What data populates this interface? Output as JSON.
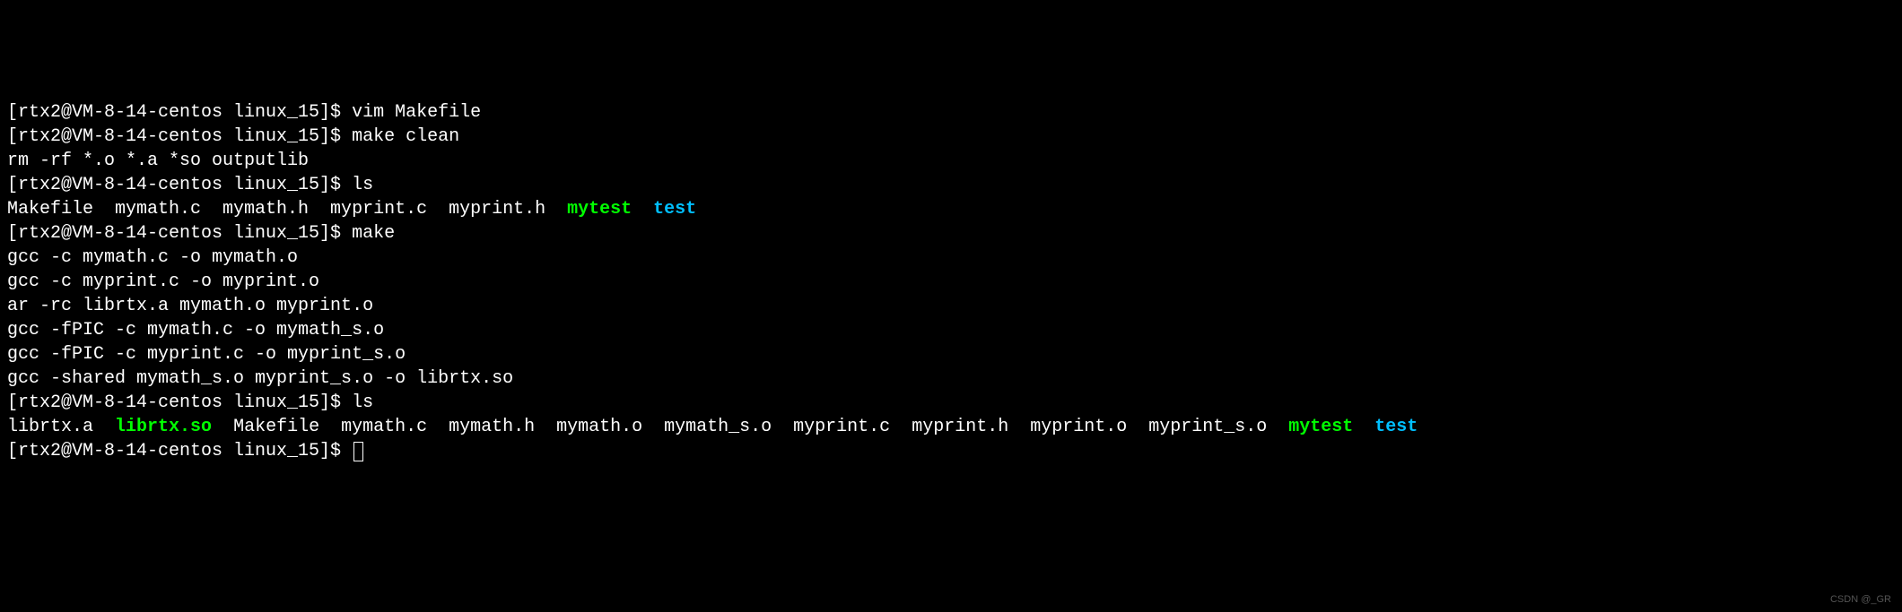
{
  "lines": [
    {
      "segments": [
        {
          "t": "[rtx2@VM-8-14-centos linux_15]$ ",
          "c": "prompt"
        },
        {
          "t": "vim Makefile",
          "c": "cmd"
        }
      ]
    },
    {
      "segments": [
        {
          "t": "[rtx2@VM-8-14-centos linux_15]$ ",
          "c": "prompt"
        },
        {
          "t": "make clean",
          "c": "cmd"
        }
      ]
    },
    {
      "segments": [
        {
          "t": "rm -rf *.o *.a *so outputlib",
          "c": "output"
        }
      ]
    },
    {
      "segments": [
        {
          "t": "[rtx2@VM-8-14-centos linux_15]$ ",
          "c": "prompt"
        },
        {
          "t": "ls",
          "c": "cmd"
        }
      ]
    },
    {
      "segments": [
        {
          "t": "Makefile  mymath.c  mymath.h  myprint.c  myprint.h  ",
          "c": "output"
        },
        {
          "t": "mytest",
          "c": "exec-green"
        },
        {
          "t": "  ",
          "c": "output"
        },
        {
          "t": "test",
          "c": "dir-blue"
        }
      ]
    },
    {
      "segments": [
        {
          "t": "[rtx2@VM-8-14-centos linux_15]$ ",
          "c": "prompt"
        },
        {
          "t": "make",
          "c": "cmd"
        }
      ]
    },
    {
      "segments": [
        {
          "t": "gcc -c mymath.c -o mymath.o",
          "c": "output"
        }
      ]
    },
    {
      "segments": [
        {
          "t": "gcc -c myprint.c -o myprint.o",
          "c": "output"
        }
      ]
    },
    {
      "segments": [
        {
          "t": "ar -rc librtx.a mymath.o myprint.o",
          "c": "output"
        }
      ]
    },
    {
      "segments": [
        {
          "t": "gcc -fPIC -c mymath.c -o mymath_s.o",
          "c": "output"
        }
      ]
    },
    {
      "segments": [
        {
          "t": "gcc -fPIC -c myprint.c -o myprint_s.o",
          "c": "output"
        }
      ]
    },
    {
      "segments": [
        {
          "t": "gcc -shared mymath_s.o myprint_s.o -o librtx.so",
          "c": "output"
        }
      ]
    },
    {
      "segments": [
        {
          "t": "[rtx2@VM-8-14-centos linux_15]$ ",
          "c": "prompt"
        },
        {
          "t": "ls",
          "c": "cmd"
        }
      ]
    },
    {
      "segments": [
        {
          "t": "librtx.a  ",
          "c": "output"
        },
        {
          "t": "librtx.so",
          "c": "exec-green"
        },
        {
          "t": "  Makefile  mymath.c  mymath.h  mymath.o  mymath_s.o  myprint.c  myprint.h  myprint.o  myprint_s.o  ",
          "c": "output"
        },
        {
          "t": "mytest",
          "c": "exec-green"
        },
        {
          "t": "  ",
          "c": "output"
        },
        {
          "t": "test",
          "c": "dir-blue"
        }
      ]
    },
    {
      "segments": [
        {
          "t": "[rtx2@VM-8-14-centos linux_15]$ ",
          "c": "prompt"
        }
      ],
      "cursor": true
    }
  ],
  "watermark": "CSDN @_GR"
}
